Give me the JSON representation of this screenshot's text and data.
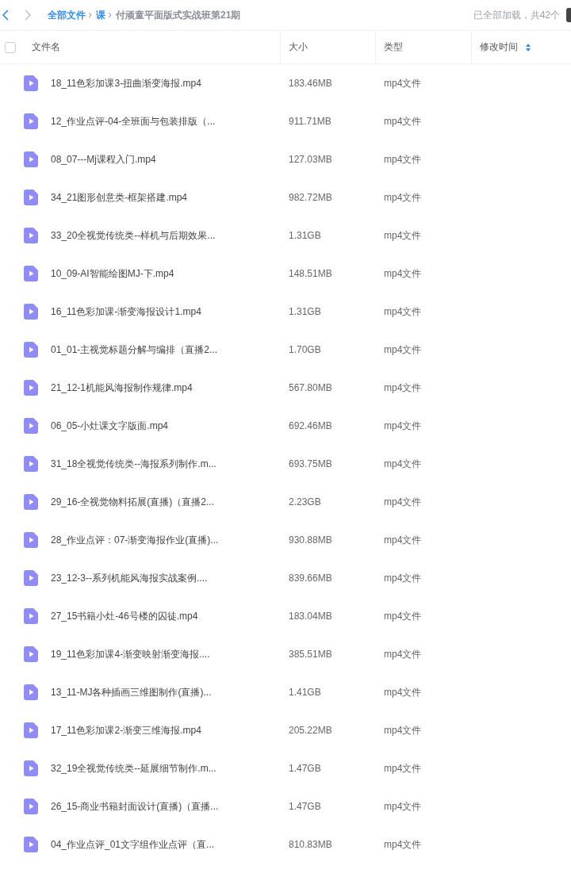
{
  "breadcrumb": [
    {
      "label": "全部文件",
      "current": false
    },
    {
      "label": "课",
      "current": false
    },
    {
      "label": "付顽童平面版式实战班第21期",
      "current": true
    }
  ],
  "load_status": "已全部加载，共42个",
  "table": {
    "select_all": {
      "checked": false
    },
    "columns": [
      {
        "label": "文件名",
        "sorted": false
      },
      {
        "label": "大小",
        "sorted": false
      },
      {
        "label": "类型",
        "sorted": false
      },
      {
        "label": "修改时间",
        "sorted": true
      }
    ],
    "rows": [
      {
        "name": "18_11色彩加课3-扭曲渐变海报.mp4",
        "size": "183.46MB",
        "type": "mp4文件"
      },
      {
        "name": "12_作业点评-04-全班面与包装排版（...",
        "size": "911.71MB",
        "type": "mp4文件"
      },
      {
        "name": "08_07---Mj课程入门.mp4",
        "size": "127.03MB",
        "type": "mp4文件"
      },
      {
        "name": "34_21图形创意类-框架搭建.mp4",
        "size": "982.72MB",
        "type": "mp4文件"
      },
      {
        "name": "33_20全视觉传统类--样机与后期效果...",
        "size": "1.31GB",
        "type": "mp4文件"
      },
      {
        "name": "10_09-AI智能绘图MJ-下.mp4",
        "size": "148.51MB",
        "type": "mp4文件"
      },
      {
        "name": "16_11色彩加课-渐变海报设计1.mp4",
        "size": "1.31GB",
        "type": "mp4文件"
      },
      {
        "name": "01_01-主视觉标题分解与编排（直播2...",
        "size": "1.70GB",
        "type": "mp4文件"
      },
      {
        "name": "21_12-1机能风海报制作规律.mp4",
        "size": "567.80MB",
        "type": "mp4文件"
      },
      {
        "name": "06_05-小灶课文字版面.mp4",
        "size": "692.46MB",
        "type": "mp4文件"
      },
      {
        "name": "31_18全视觉传统类--海报系列制作.m...",
        "size": "693.75MB",
        "type": "mp4文件"
      },
      {
        "name": "29_16-全视觉物料拓展(直播)（直播2...",
        "size": "2.23GB",
        "type": "mp4文件"
      },
      {
        "name": "28_作业点评：07-渐变海报作业(直播)...",
        "size": "930.88MB",
        "type": "mp4文件"
      },
      {
        "name": "23_12-3--系列机能风海报实战案例....",
        "size": "839.66MB",
        "type": "mp4文件"
      },
      {
        "name": "27_15书籍小灶-46号楼的囚徒.mp4",
        "size": "183.04MB",
        "type": "mp4文件"
      },
      {
        "name": "19_11色彩加课4-渐变映射渐变海报....",
        "size": "385.51MB",
        "type": "mp4文件"
      },
      {
        "name": "13_11-MJ各种插画三维图制作(直播)...",
        "size": "1.41GB",
        "type": "mp4文件"
      },
      {
        "name": "17_11色彩加课2-渐变三维海报.mp4",
        "size": "205.22MB",
        "type": "mp4文件"
      },
      {
        "name": "32_19全视觉传统类--延展细节制作.m...",
        "size": "1.47GB",
        "type": "mp4文件"
      },
      {
        "name": "26_15-商业书籍封面设计(直播)（直播...",
        "size": "1.47GB",
        "type": "mp4文件"
      },
      {
        "name": "04_作业点评_01文字组作业点评（直...",
        "size": "810.83MB",
        "type": "mp4文件"
      }
    ]
  }
}
